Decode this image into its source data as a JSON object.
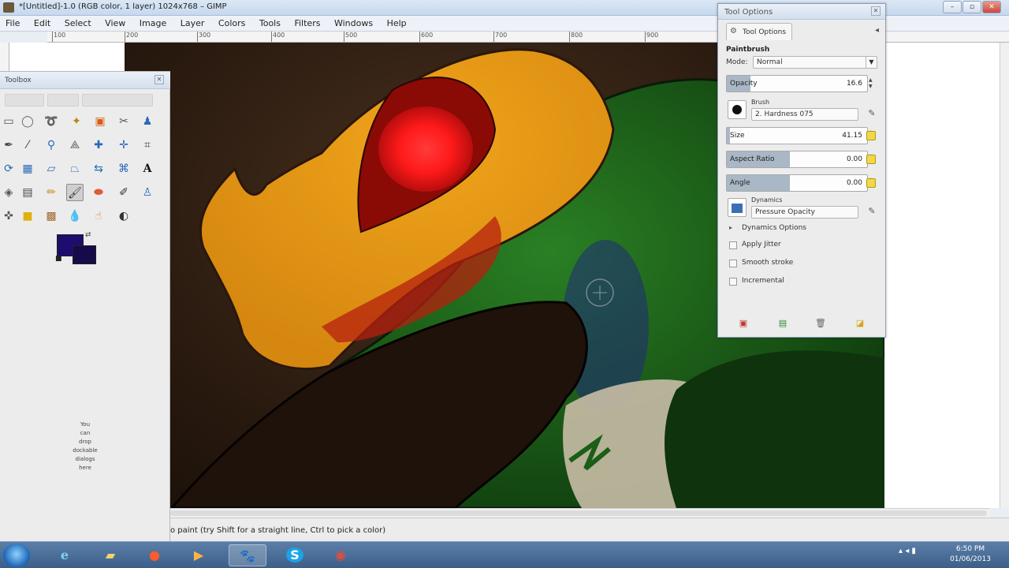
{
  "window": {
    "title": "*[Untitled]-1.0 (RGB color, 1 layer) 1024x768 – GIMP"
  },
  "menu": [
    "File",
    "Edit",
    "Select",
    "View",
    "Image",
    "Layer",
    "Colors",
    "Tools",
    "Filters",
    "Windows",
    "Help"
  ],
  "ruler": {
    "ticks": [
      "100",
      "200",
      "300",
      "400",
      "500",
      "600",
      "700",
      "800",
      "900"
    ]
  },
  "toolbox": {
    "title": "Toolbox",
    "tools": [
      "rect-select",
      "ellipse-select",
      "free-select",
      "fuzzy-select",
      "color-select",
      "scissors-select",
      "foreground-select",
      "paths",
      "color-picker",
      "zoom",
      "measure",
      "move",
      "align",
      "crop",
      "rotate",
      "scale",
      "shear",
      "perspective",
      "flip",
      "text",
      "cage-transform",
      "bucket-fill",
      "blend",
      "pencil",
      "paintbrush",
      "eraser",
      "airbrush",
      "ink",
      "heal",
      "clone",
      "perspective-clone",
      "blur",
      "smudge",
      "dodge-burn"
    ],
    "active_tool": "paintbrush",
    "foreground_color": "#1e0d6e",
    "background_color": "#170a4a",
    "tip_lines": [
      "You",
      "can",
      "drop",
      "dockable",
      "dialogs",
      "here"
    ]
  },
  "tool_options": {
    "title": "Tool Options",
    "tab_label": "Tool Options",
    "tool_name": "Paintbrush",
    "mode_label": "Mode:",
    "mode_value": "Normal",
    "opacity_label": "Opacity",
    "opacity_value": "16.6",
    "opacity_fraction": 0.166,
    "brush_label": "Brush",
    "brush_value": "2. Hardness 075",
    "size_label": "Size",
    "size_value": "41.15",
    "size_fraction": 0.02,
    "aspect_label": "Aspect Ratio",
    "aspect_value": "0.00",
    "aspect_fraction": 0.45,
    "angle_label": "Angle",
    "angle_value": "0.00",
    "angle_fraction": 0.45,
    "dynamics_label": "Dynamics",
    "dynamics_value": "Pressure Opacity",
    "dynamics_options_label": "Dynamics Options",
    "apply_jitter_label": "Apply Jitter",
    "smooth_stroke_label": "Smooth stroke",
    "incremental_label": "Incremental"
  },
  "status": {
    "message": "o paint (try Shift for a straight line, Ctrl to pick a color)"
  },
  "taskbar": {
    "apps": [
      "internet-explorer",
      "file-explorer",
      "media-player",
      "media-center",
      "gimp",
      "skype",
      "chrome"
    ],
    "active_app": "gimp",
    "time": "6:50 PM",
    "date": "01/06/2013"
  },
  "colors": {
    "skin_orange": "#e69a14",
    "eye_red": "#ff1a1a",
    "body_green": "#1f6e1c",
    "canvas_dark": "#2b1b10"
  }
}
